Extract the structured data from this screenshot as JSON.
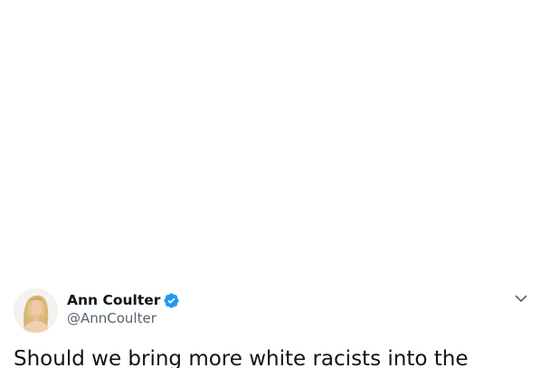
{
  "tweet": {
    "author": {
      "display_name": "Ann Coulter",
      "handle": "@AnnCoulter",
      "verified": true,
      "avatar_icon": "profile-photo"
    },
    "text": "Should we bring more white racists into the",
    "more_icon": "chevron-down-icon"
  },
  "colors": {
    "verified_blue": "#1d9bf0",
    "text_primary": "#0f1419",
    "text_secondary": "#536471"
  }
}
